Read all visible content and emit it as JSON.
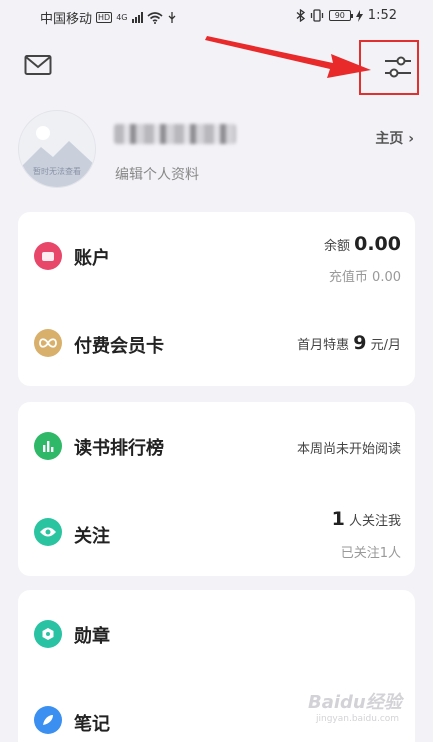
{
  "status_bar": {
    "carrier": "中国移动",
    "hd": "HD",
    "network": "4G",
    "battery": "90",
    "time": "1:52"
  },
  "header": {
    "mail_icon": "mail-icon",
    "settings_icon": "sliders-icon",
    "highlight_color": "#e03030"
  },
  "profile": {
    "avatar_placeholder": "暂时无法查看",
    "edit_label": "编辑个人资料",
    "homepage_label": "主页 ›"
  },
  "account_card": {
    "account": {
      "label": "账户",
      "balance_prefix": "余额",
      "balance_value": "0.00",
      "coins_label": "充值币 0.00"
    },
    "membership": {
      "label": "付费会员卡",
      "promo_prefix": "首月特惠",
      "promo_value": "9",
      "promo_suffix": "元/月"
    }
  },
  "reading_card": {
    "ranking": {
      "label": "读书排行榜",
      "status": "本周尚未开始阅读"
    },
    "follow": {
      "label": "关注",
      "followers_value": "1",
      "followers_suffix": "人关注我",
      "following": "已关注1人"
    }
  },
  "extra_card": {
    "medals_label": "勋章",
    "notes_label": "笔记"
  },
  "watermark": {
    "brand": "Baidu经验",
    "url": "jingyan.baidu.com"
  },
  "colors": {
    "account": "#e8476a",
    "membership": "#d9b06b",
    "ranking": "#2fb867",
    "follow": "#2bc4a0",
    "medals": "#29c3a4",
    "notes": "#3a8ff0"
  }
}
